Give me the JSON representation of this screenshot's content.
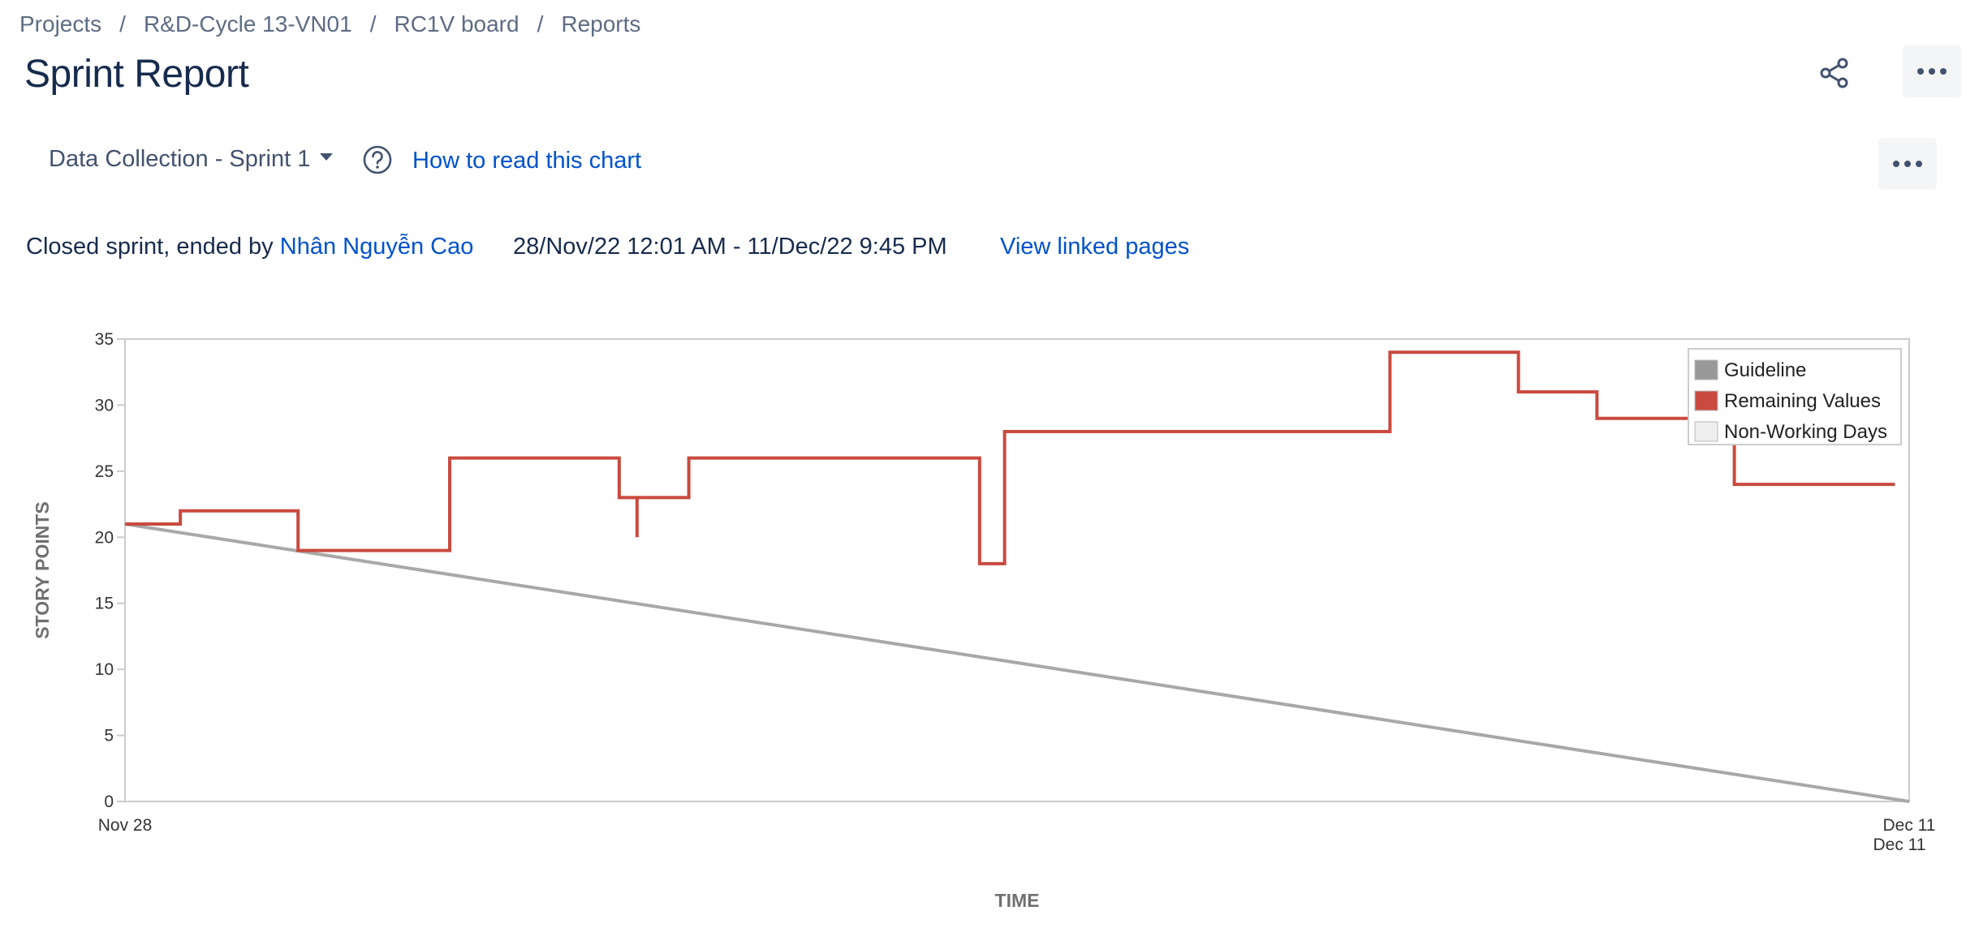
{
  "breadcrumb": {
    "items": [
      "Projects",
      "R&D-Cycle 13-VN01",
      "RC1V board",
      "Reports"
    ],
    "separator": "/"
  },
  "page_title": "Sprint Report",
  "toolbar": {
    "share_icon": "share-icon",
    "more_icon": "more-horizontal-icon"
  },
  "report_controls": {
    "sprint_selected": "Data Collection - Sprint 1",
    "help_icon": "question-circle-icon",
    "how_to_read": "How to read this chart"
  },
  "sprint_info": {
    "status_prefix": "Closed sprint, ended by",
    "ended_by": "Nhân Nguyễn Cao",
    "date_range": "28/Nov/22 12:01 AM - 11/Dec/22 9:45 PM",
    "linked_pages": "View linked pages"
  },
  "chart_data": {
    "type": "line",
    "xlabel": "TIME",
    "ylabel": "STORY POINTS",
    "ylim": [
      0,
      35
    ],
    "yticks": [
      "0",
      "5",
      "10",
      "15",
      "20",
      "25",
      "30",
      "35"
    ],
    "xlim": [
      "Nov 28",
      "Dec 11"
    ],
    "x_tick_labels": {
      "start": "Nov 28",
      "end": [
        "Dec 11",
        "Dec 11"
      ]
    },
    "legend_position": "top-right",
    "legend": [
      {
        "name": "Guideline",
        "color": "#999999"
      },
      {
        "name": "Remaining Values",
        "color": "#c94a3f"
      },
      {
        "name": "Non-Working Days",
        "color": "#eeeeee"
      }
    ],
    "series": [
      {
        "name": "Guideline",
        "color": "#a8a8a8",
        "points": [
          [
            0,
            21
          ],
          [
            1,
            0
          ]
        ]
      },
      {
        "name": "Remaining Values",
        "color": "#c94a3f",
        "step_points": [
          [
            0.0,
            21
          ],
          [
            0.031,
            21
          ],
          [
            0.031,
            22
          ],
          [
            0.097,
            22
          ],
          [
            0.097,
            19
          ],
          [
            0.182,
            19
          ],
          [
            0.182,
            26
          ],
          [
            0.277,
            26
          ],
          [
            0.277,
            23
          ],
          [
            0.287,
            23
          ],
          [
            0.287,
            20
          ],
          [
            0.287,
            23
          ],
          [
            0.316,
            23
          ],
          [
            0.316,
            26
          ],
          [
            0.479,
            26
          ],
          [
            0.479,
            18
          ],
          [
            0.493,
            18
          ],
          [
            0.493,
            28
          ],
          [
            0.709,
            28
          ],
          [
            0.709,
            34
          ],
          [
            0.781,
            34
          ],
          [
            0.781,
            31
          ],
          [
            0.825,
            31
          ],
          [
            0.825,
            29
          ],
          [
            0.902,
            29
          ],
          [
            0.902,
            24
          ],
          [
            0.992,
            24
          ]
        ]
      }
    ]
  }
}
